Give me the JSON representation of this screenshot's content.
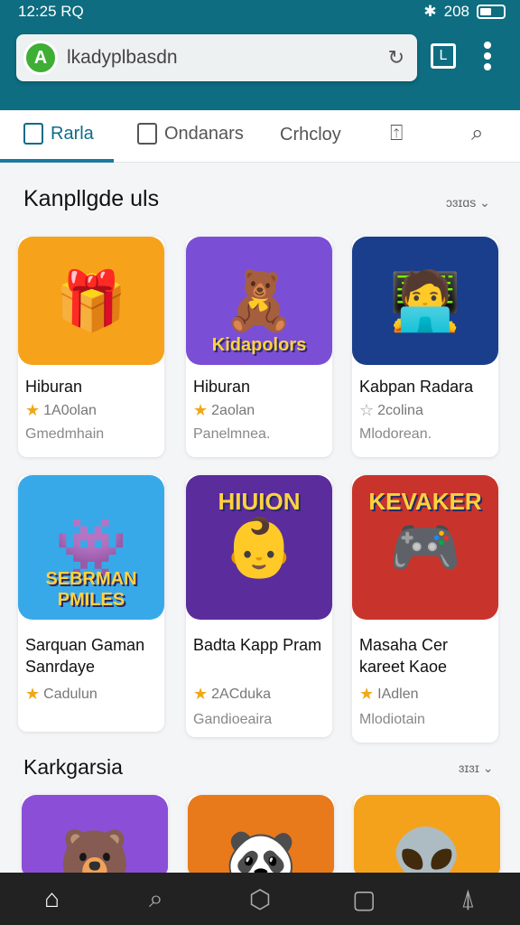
{
  "status": {
    "time": "12:25 RQ",
    "right_text": "208"
  },
  "url_bar": {
    "text": "lkadyplbasdn"
  },
  "tabs": [
    {
      "label": "Rarla"
    },
    {
      "label": "Ondanars"
    },
    {
      "label": "Crhcloy"
    }
  ],
  "sections": [
    {
      "title": "Kanpllgde uls",
      "see_all": "ɔɜɪɑs",
      "cards": [
        {
          "title": "Hiburan",
          "rating": "1A0olan",
          "subtitle": "Gmedmhain",
          "icon": "boy-with-gifts",
          "color": "#f6a21b"
        },
        {
          "title": "Hiburan",
          "rating": "2aolan",
          "subtitle": "Panelmnea.",
          "icon": "bear-with-blocks",
          "color": "#7a4fd6",
          "overlay": "Kidapolors"
        },
        {
          "title": "Kabpan Radara",
          "rating": "2colina",
          "subtitle": "Mlodorean.",
          "icon": "man-with-tablet",
          "color": "#1a3e8c"
        }
      ]
    },
    {
      "title": "",
      "see_all": "",
      "cards": [
        {
          "title": "Sarquan Gaman Sanrdaye",
          "rating": "Cadulun",
          "subtitle": "",
          "icon": "colorful-monster",
          "color": "#38a9e8",
          "overlay": "SEBRMAN PMILES"
        },
        {
          "title": "Badta Kapp Pram",
          "rating": "2ACduka",
          "subtitle": "Gandioeaira",
          "icon": "baby-with-gifts",
          "color": "#5a2c9c",
          "overlay": "HIUION"
        },
        {
          "title": "Masaha Cer kareet Kaoe",
          "rating": "IAdlen",
          "subtitle": "Mlodiotain",
          "icon": "gamer-kid",
          "color": "#c8342c",
          "overlay": "KEVAKER"
        }
      ]
    },
    {
      "title": "Karkgarsia",
      "see_all": "ɜɪɜɪ",
      "cards": [
        {
          "icon": "yellow-bear",
          "color": "#8a4fd6"
        },
        {
          "icon": "pink-bear-gamer",
          "color": "#e87a1c"
        },
        {
          "icon": "blue-creature",
          "color": "#f4a21b"
        }
      ]
    }
  ]
}
